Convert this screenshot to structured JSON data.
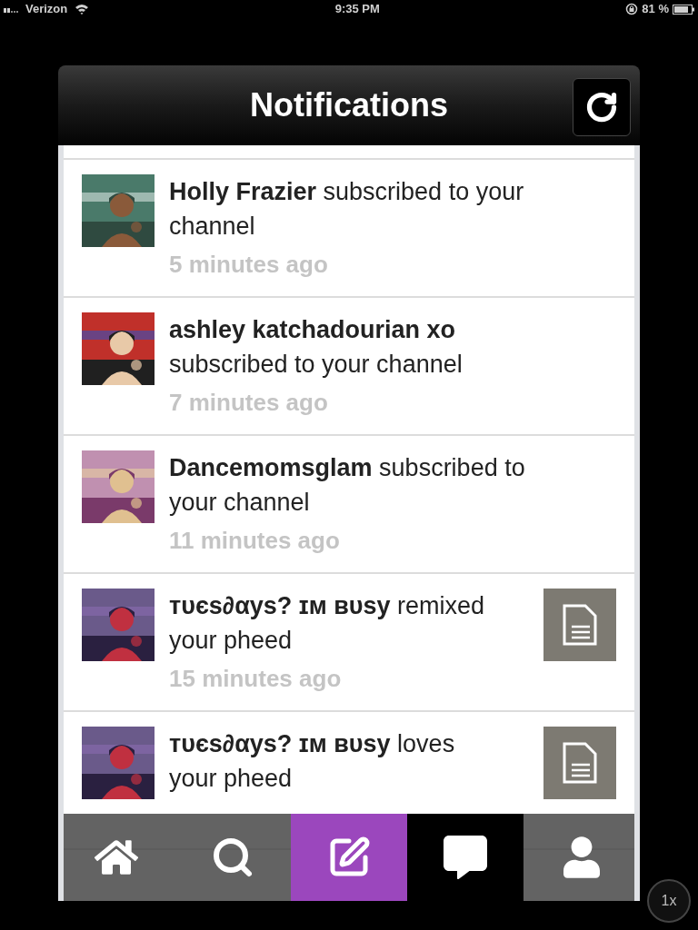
{
  "status_bar": {
    "carrier": "Verizon",
    "time": "9:35 PM",
    "battery": "81 %"
  },
  "header": {
    "title": "Notifications"
  },
  "notifications": [
    {
      "message": "**Holly Frazier** subscribed to your channel",
      "time": "5 minutes ago"
    },
    {
      "message": "**ashley katchadourian xo** subscribed to your channel",
      "time": "7 minutes ago"
    },
    {
      "message": "**Dancemomsglam** subscribed to your channel",
      "time": "11 minutes ago"
    },
    {
      "message": "**ᴛᴜєѕ∂αуѕ? ɪᴍ ʙᴜѕу** remixed your pheed",
      "time": "15 minutes ago",
      "thumbnail": {
        "kind": "document"
      }
    },
    {
      "message": "**ᴛᴜєѕ∂αуѕ? ɪᴍ ʙᴜѕу** loves your pheed",
      "thumbnail": {
        "kind": "document"
      }
    }
  ],
  "tab_bar": [
    {
      "kind": "home",
      "selected": false
    },
    {
      "kind": "search",
      "selected": false
    },
    {
      "kind": "compose",
      "selected": false
    },
    {
      "kind": "notifications",
      "selected": true
    },
    {
      "kind": "profile",
      "selected": false
    }
  ],
  "zoom_button": "1x"
}
